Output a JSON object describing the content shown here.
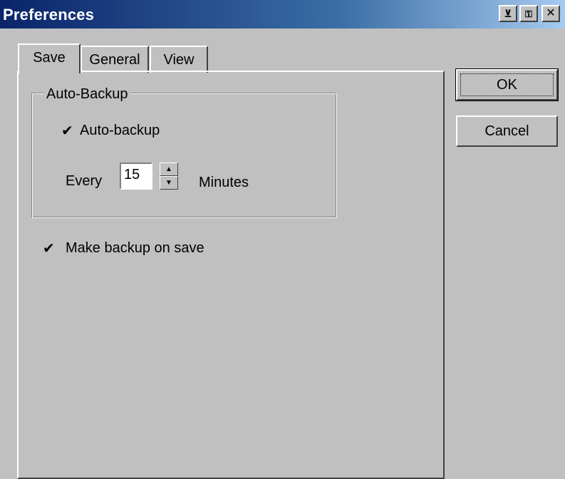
{
  "window": {
    "title": "Preferences",
    "controls": [
      "pin-icon",
      "key-icon",
      "close-icon"
    ]
  },
  "tabs": [
    {
      "label": "Save",
      "active": true
    },
    {
      "label": "General",
      "active": false
    },
    {
      "label": "View",
      "active": false
    }
  ],
  "auto_backup_group": {
    "title": "Auto-Backup",
    "checkbox_label": "Auto-backup",
    "checked": true,
    "every_label": "Every",
    "interval_value": "15",
    "unit_label": "Minutes"
  },
  "make_backup": {
    "label": "Make backup on save",
    "checked": true
  },
  "buttons": {
    "ok": "OK",
    "cancel": "Cancel"
  },
  "glyphs": {
    "check": "✔",
    "up": "▲",
    "down": "▼",
    "pin": "⊻",
    "key": "🔑",
    "close": "✕"
  }
}
